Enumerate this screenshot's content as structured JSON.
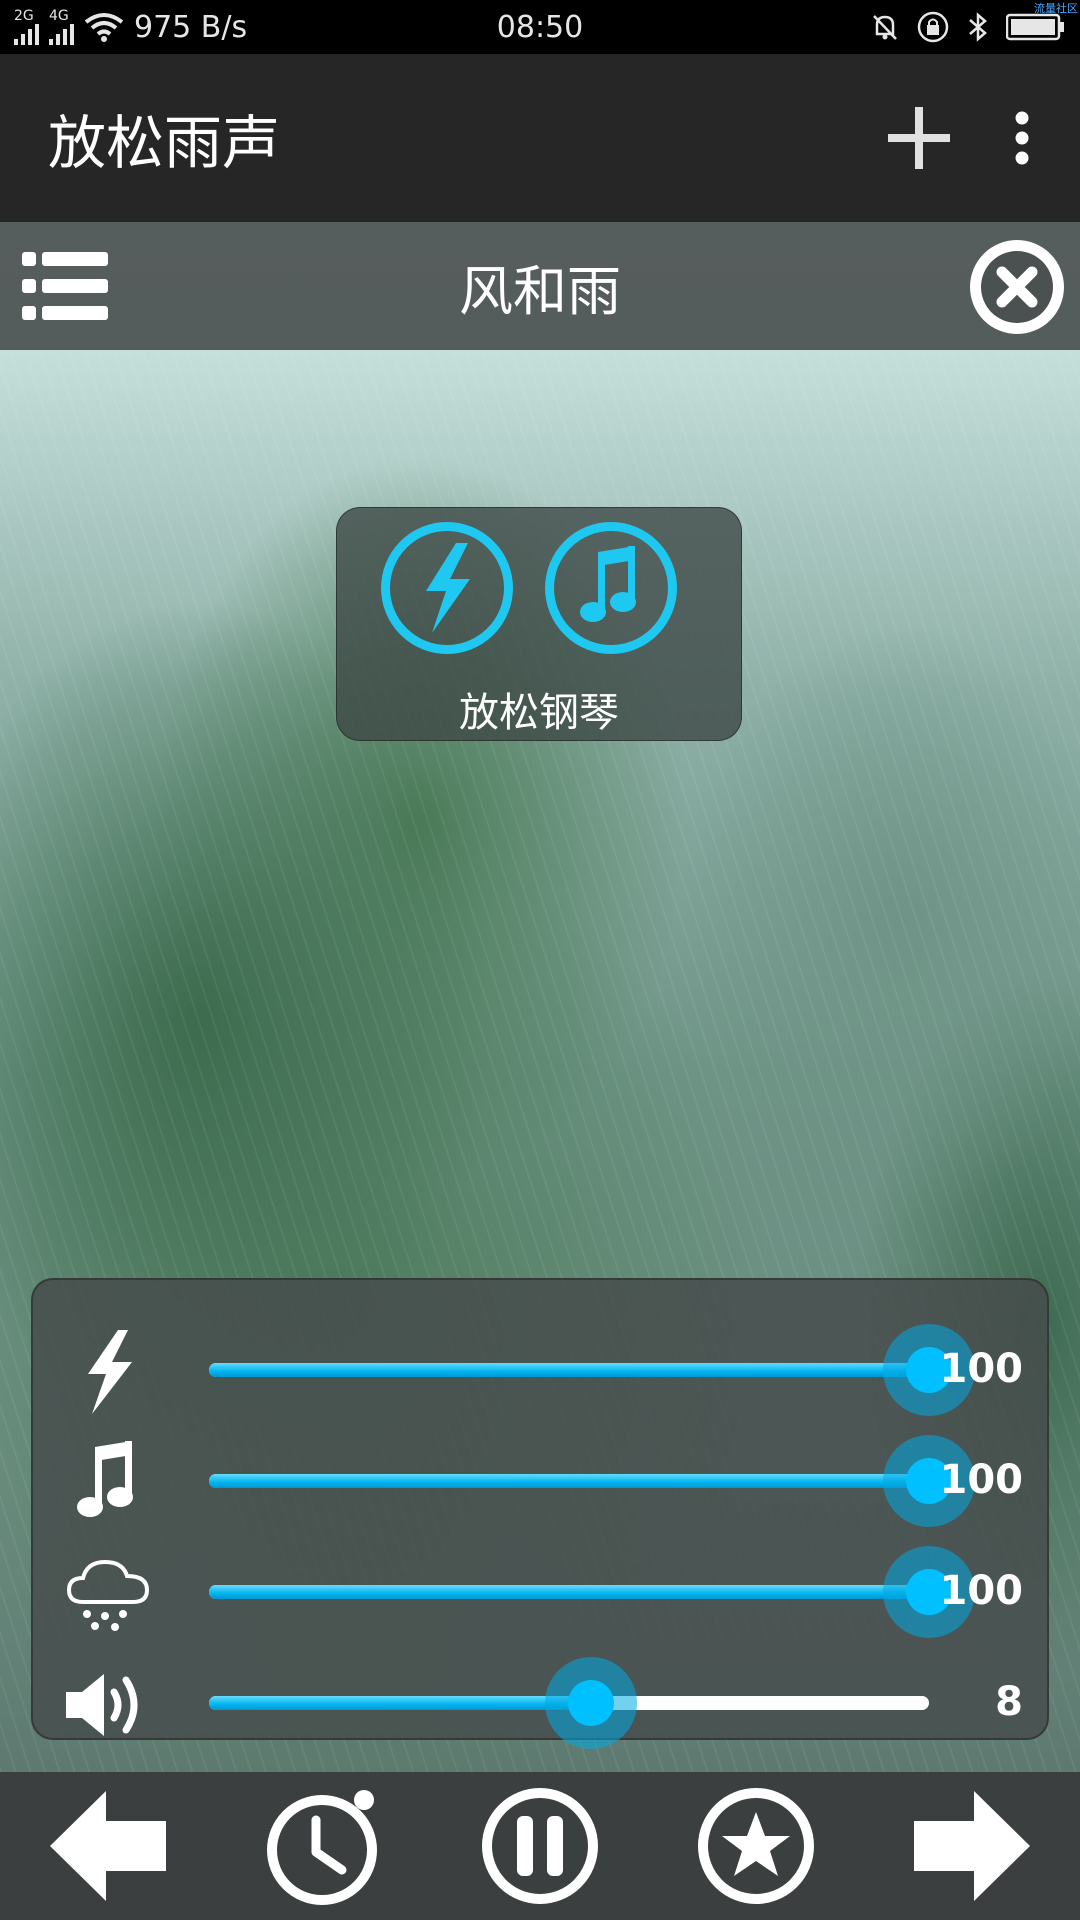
{
  "status_bar": {
    "network_2g": "2G",
    "network_4g": "4G",
    "speed": "975 B/s",
    "time": "08:50",
    "corner_note": "流量社区"
  },
  "app_bar": {
    "title": "放松雨声",
    "add_icon": "plus-icon",
    "more_icon": "more-vert-icon"
  },
  "scene": {
    "title": "风和雨",
    "playlist_icon": "list-icon",
    "close_icon": "close-circle-icon"
  },
  "sound_group": {
    "label": "放松钢琴",
    "icons": [
      "lightning-icon",
      "music-note-icon"
    ]
  },
  "mixer": {
    "rows": [
      {
        "icon": "lightning-icon",
        "value": "100",
        "level": 1.0
      },
      {
        "icon": "music-note-icon",
        "value": "100",
        "level": 1.0
      },
      {
        "icon": "rain-cloud-icon",
        "value": "100",
        "level": 1.0
      },
      {
        "icon": "volume-icon",
        "value": "8",
        "level": 0.53
      }
    ]
  },
  "controls": [
    "arrow-left-icon",
    "timer-icon",
    "pause-icon",
    "star-icon",
    "arrow-right-icon"
  ],
  "colors": {
    "accent": "#1fc8f0",
    "status_bar": "#000000",
    "app_bar": "#262626",
    "control_bar": "#3c3f3f"
  }
}
